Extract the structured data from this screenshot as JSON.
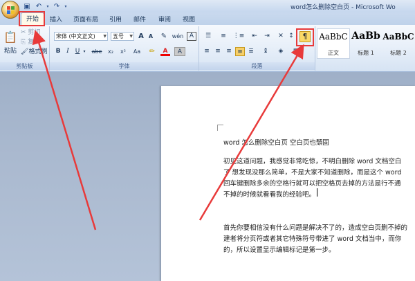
{
  "window": {
    "title": "word怎么删除空白页 - Microsoft Wo"
  },
  "quick_access": {
    "icons": [
      "save-icon",
      "undo-icon",
      "redo-icon"
    ]
  },
  "tabs": [
    {
      "label": "开始"
    },
    {
      "label": "插入"
    },
    {
      "label": "页面布局"
    },
    {
      "label": "引用"
    },
    {
      "label": "邮件"
    },
    {
      "label": "审阅"
    },
    {
      "label": "视图"
    }
  ],
  "clipboard": {
    "paste": "粘贴",
    "cut": "剪切",
    "copy": "复制",
    "format_painter": "格式刷",
    "label": "剪贴板"
  },
  "font": {
    "name": "宋体 (中文正文)",
    "size": "五号",
    "grow": "A",
    "shrink": "A",
    "label": "字体",
    "bold": "B",
    "italic": "I",
    "underline": "U",
    "strike": "abe",
    "sub": "x₂",
    "sup": "x²",
    "case": "Aa",
    "color": "A",
    "wen": "wén",
    "border": "A"
  },
  "paragraph": {
    "label": "段落",
    "pilcrow": "¶"
  },
  "styles": [
    {
      "sample": "AaBbC",
      "name": "正文"
    },
    {
      "sample": "AaBb",
      "name": "标题 1"
    },
    {
      "sample": "AaBbC",
      "name": "标题 2"
    }
  ],
  "document": {
    "title_line": "word 怎么删除空白页  空白页也頹固",
    "para1": [
      "初见这道问题，我感觉非常吃惊，不明白删除 word 文档空白",
      "了 想发现没那么简单，不是大家不知道删除，而是这个 word",
      "回车键删除多余的空格行就可以把空格页去掉的方法是行不通",
      "不掉的时候就看看我的经验吧。"
    ],
    "para2": [
      "首先你要相信没有什么问题是解决不了的，造成空白页删不掉的",
      "建者将分页符或者其它特殊符号带进了 word 文档当中，而你",
      "的，所以设置显示编辑标记是第一步。"
    ]
  },
  "colors": {
    "highlight": "#e83a3a",
    "arrow": "#e83a3a"
  }
}
